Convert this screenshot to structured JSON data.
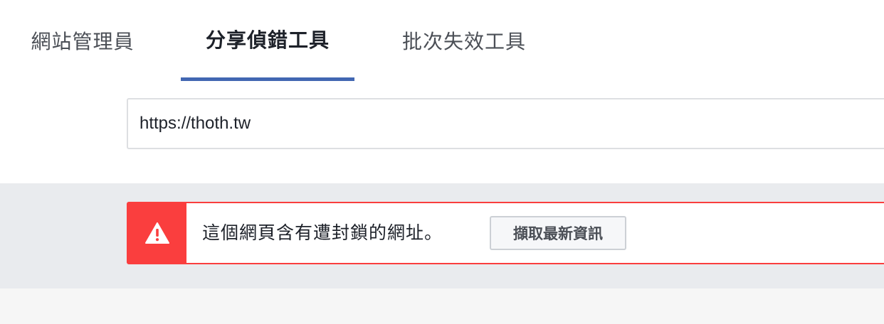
{
  "tabs": [
    {
      "label": "網站管理員",
      "active": false
    },
    {
      "label": "分享偵錯工具",
      "active": true
    },
    {
      "label": "批次失效工具",
      "active": false
    }
  ],
  "url_input": {
    "value": "https://thoth.tw"
  },
  "alert": {
    "message": "這個網頁含有遭封鎖的網址。",
    "button_label": "擷取最新資訊",
    "icon": "warning-triangle-icon"
  },
  "colors": {
    "accent": "#4267b2",
    "error": "#fa3e3e",
    "band": "#e9ebee"
  }
}
